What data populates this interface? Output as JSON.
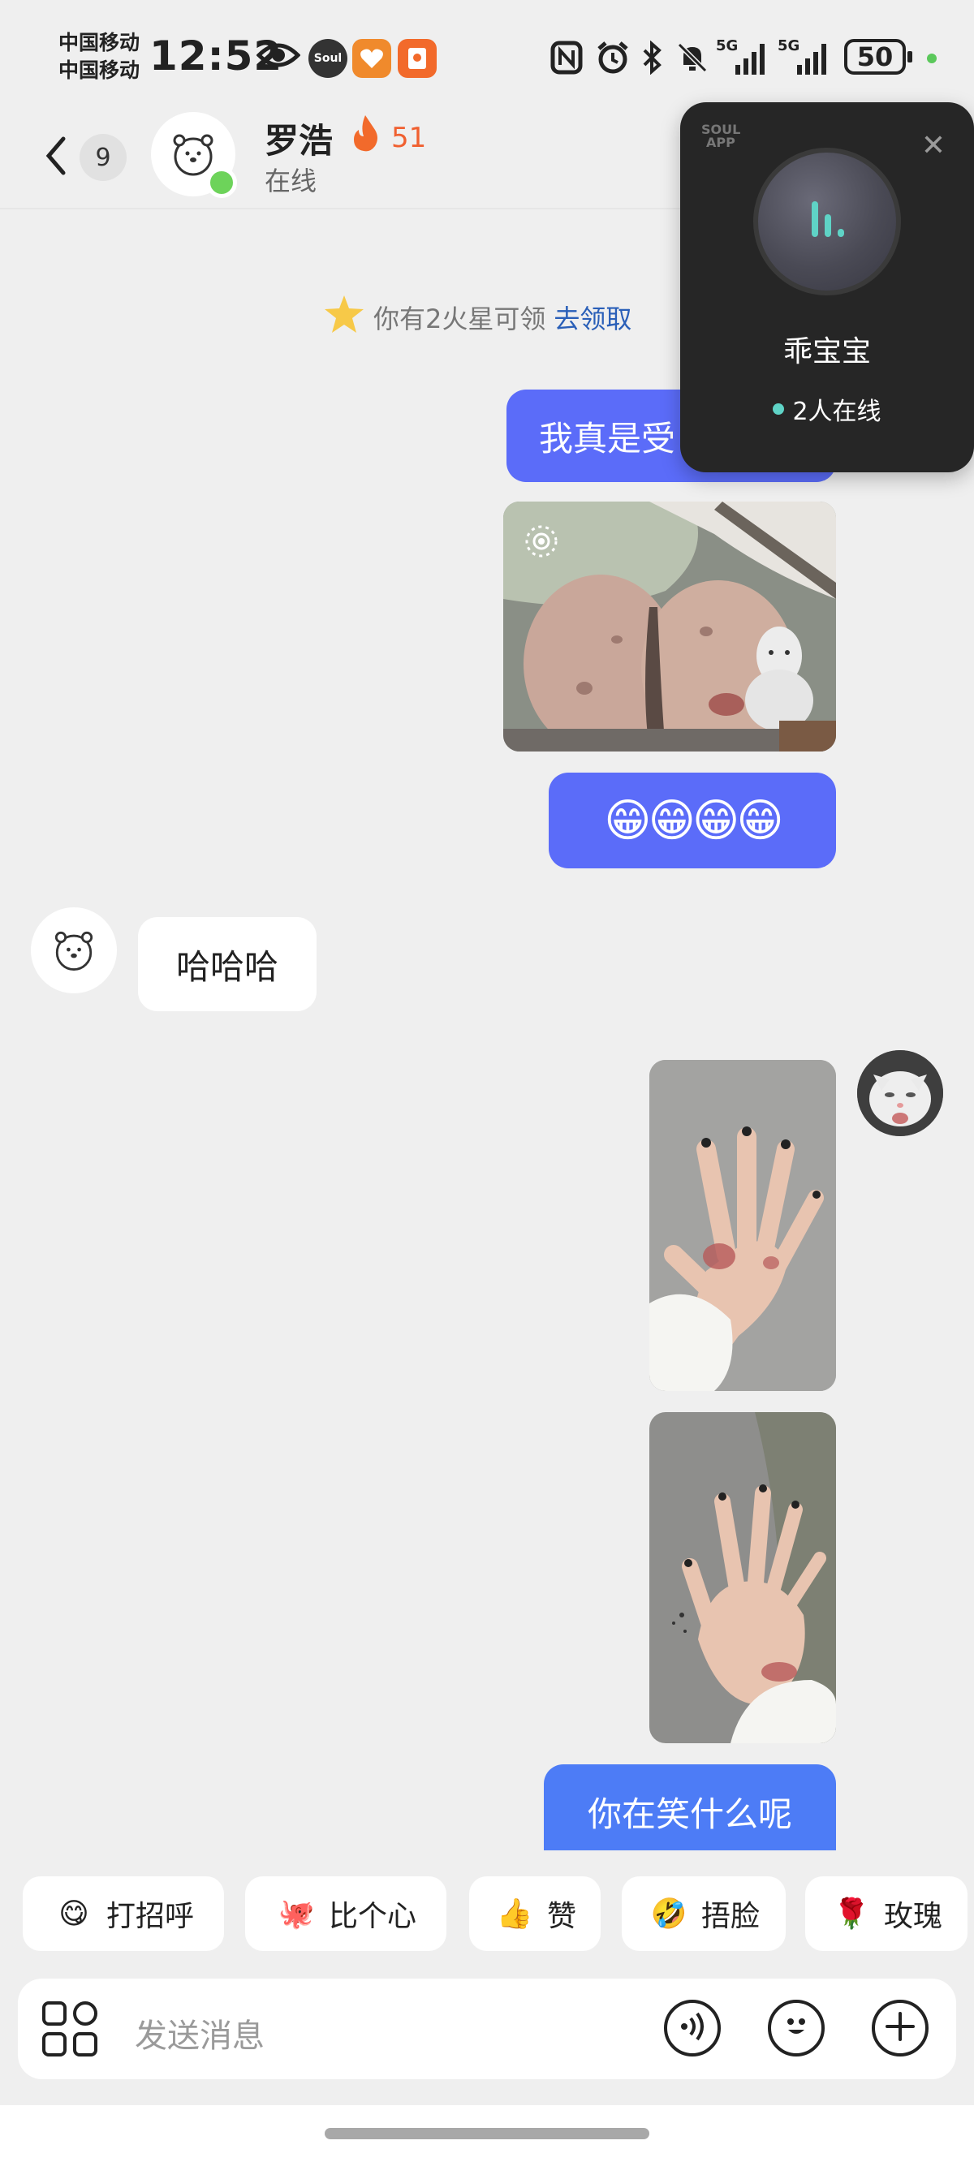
{
  "status_bar": {
    "carrier_1": "中国移动",
    "carrier_2": "中国移动",
    "time": "12:52",
    "app_badge": "Soul",
    "battery": "50",
    "network_1": "5G",
    "network_2": "5G"
  },
  "header": {
    "back_count": "9",
    "name": "罗浩",
    "fire_count": "51",
    "status": "在线"
  },
  "notice": {
    "text": "你有2火星可领",
    "link": "去领取"
  },
  "messages": {
    "msg1": "我真是受",
    "msg2": "😁😁😁😁",
    "msg3": "哈哈哈",
    "msg4": "你在笑什么呢"
  },
  "voice_room": {
    "logo_line1": "SOUL",
    "logo_line2": "APP",
    "name": "乖宝宝",
    "online": "2人在线"
  },
  "quick_replies": [
    {
      "label": "打招呼",
      "emoji": "😋"
    },
    {
      "label": "比个心",
      "emoji": "🐙"
    },
    {
      "label": "赞",
      "emoji": "👍"
    },
    {
      "label": "捂脸",
      "emoji": "🤣"
    },
    {
      "label": "玫瑰",
      "emoji": "🌹"
    }
  ],
  "input": {
    "placeholder": "发送消息"
  },
  "colors": {
    "accent_bubble": "#5b6cf9",
    "online": "#6dd35a",
    "link": "#2a5fb8"
  }
}
